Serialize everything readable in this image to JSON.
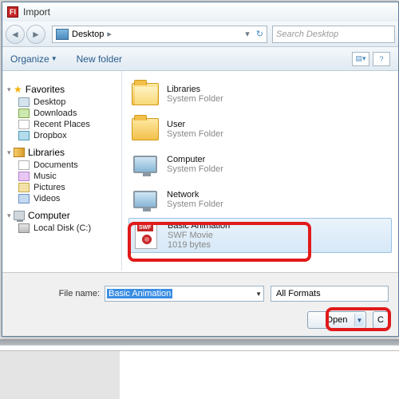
{
  "window": {
    "title": "Import"
  },
  "nav": {
    "crumb": "Desktop",
    "search_placeholder": "Search Desktop"
  },
  "toolbar": {
    "organize": "Organize",
    "new_folder": "New folder"
  },
  "sidebar": {
    "favorites": {
      "label": "Favorites",
      "items": [
        "Desktop",
        "Downloads",
        "Recent Places",
        "Dropbox"
      ]
    },
    "libraries": {
      "label": "Libraries",
      "items": [
        "Documents",
        "Music",
        "Pictures",
        "Videos"
      ]
    },
    "computer": {
      "label": "Computer",
      "items": [
        "Local Disk (C:)"
      ]
    }
  },
  "items": [
    {
      "name": "Libraries",
      "sub": "System Folder"
    },
    {
      "name": "User",
      "sub": "System Folder"
    },
    {
      "name": "Computer",
      "sub": "System Folder"
    },
    {
      "name": "Network",
      "sub": "System Folder"
    },
    {
      "name": "Basic Animation",
      "sub": "SWF Movie",
      "size": "1019 bytes"
    }
  ],
  "bottom": {
    "filename_label": "File name:",
    "filename_value": "Basic Animation",
    "formats": "All Formats",
    "open": "Open",
    "cancel": "C"
  }
}
